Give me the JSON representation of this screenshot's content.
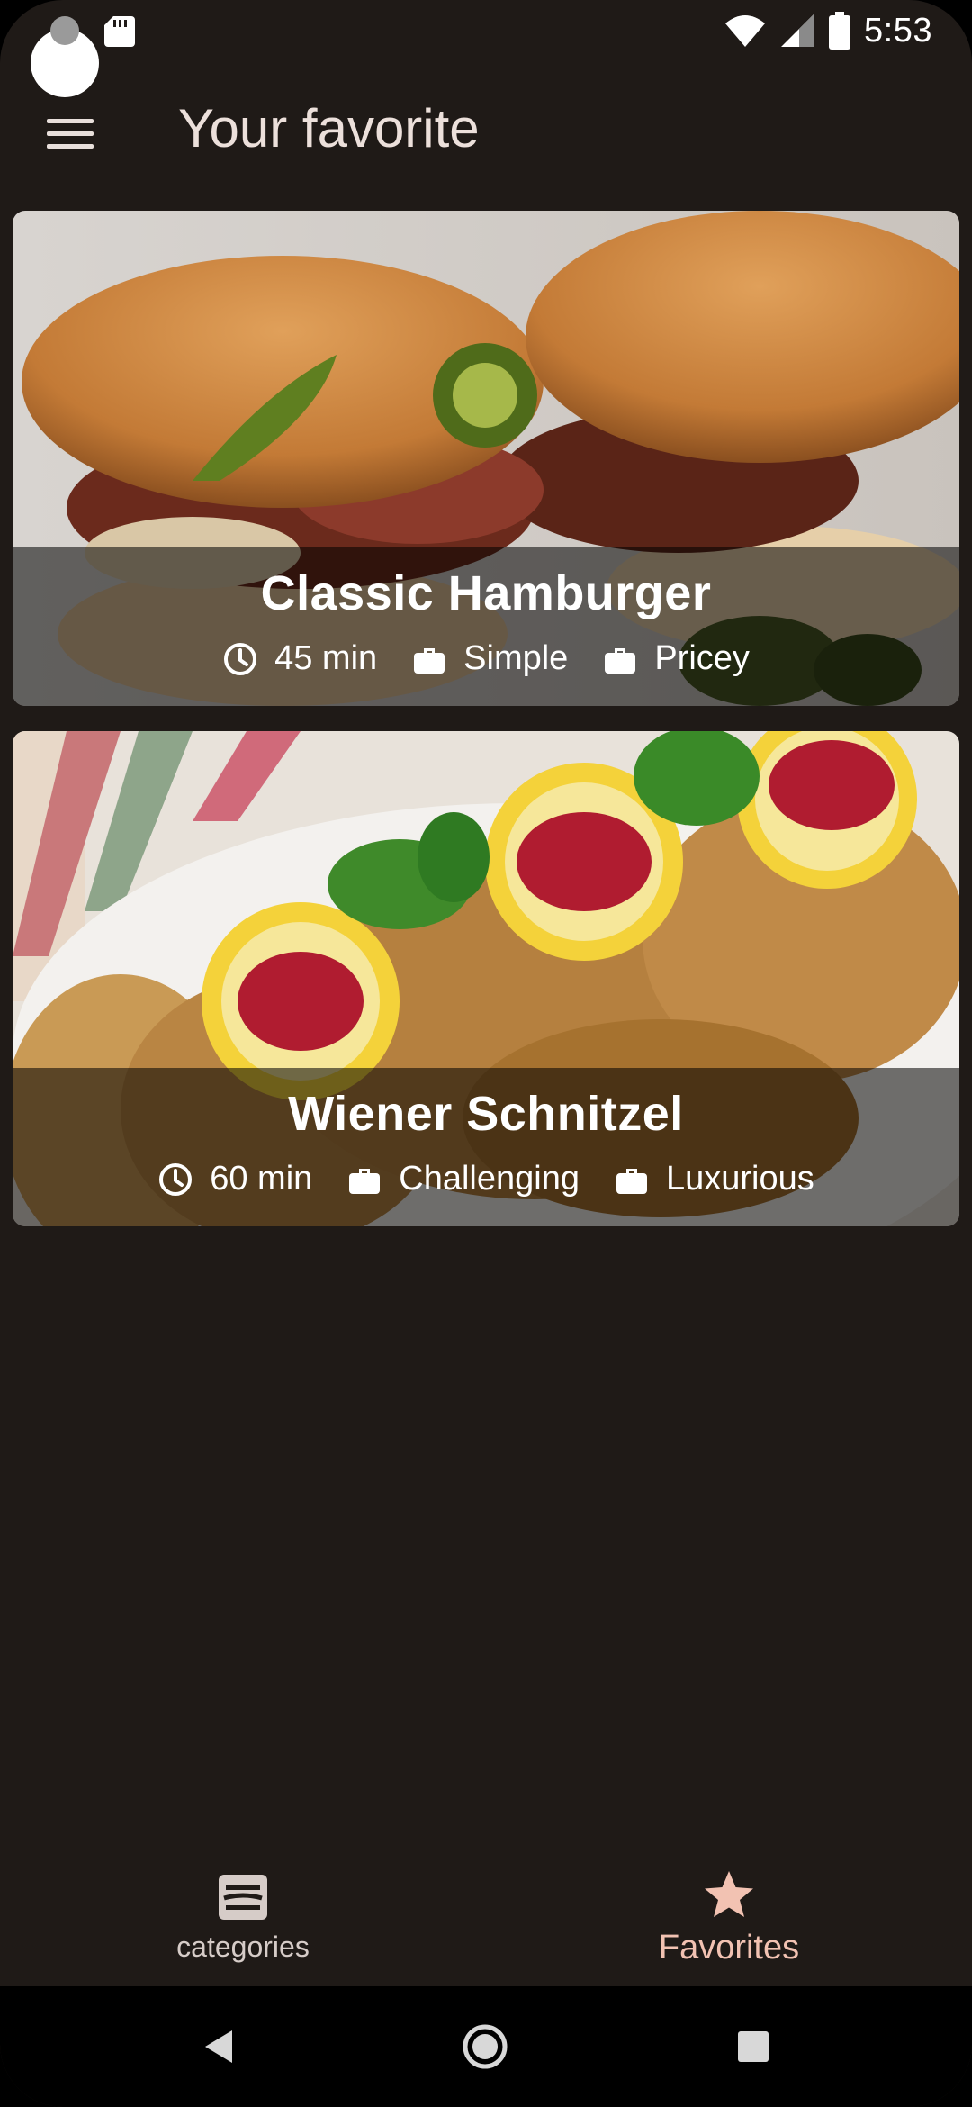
{
  "status_bar": {
    "time": "5:53",
    "icons": [
      "sd-card-icon",
      "wifi-icon",
      "cellular-signal-icon",
      "battery-icon"
    ]
  },
  "app_bar": {
    "menu_icon": "hamburger-menu-icon",
    "title": "Your favorite"
  },
  "meals": [
    {
      "title": "Classic Hamburger",
      "duration": "45 min",
      "complexity": "Simple",
      "affordability": "Pricey",
      "image": "hamburger-photo"
    },
    {
      "title": "Wiener Schnitzel",
      "duration": "60 min",
      "complexity": "Challenging",
      "affordability": "Luxurious",
      "image": "schnitzel-photo"
    }
  ],
  "bottom_nav": {
    "items": [
      {
        "label": "categories",
        "icon": "dish-icon",
        "selected": false
      },
      {
        "label": "Favorites",
        "icon": "star-icon",
        "selected": true
      }
    ]
  },
  "system_nav": {
    "buttons": [
      "back-icon",
      "home-icon",
      "recents-icon"
    ]
  },
  "colors": {
    "background": "#1f1a17",
    "title_text": "#ece0db",
    "selected_accent": "#f2c2b2",
    "overlay": "rgba(0,0,0,0.55)"
  }
}
